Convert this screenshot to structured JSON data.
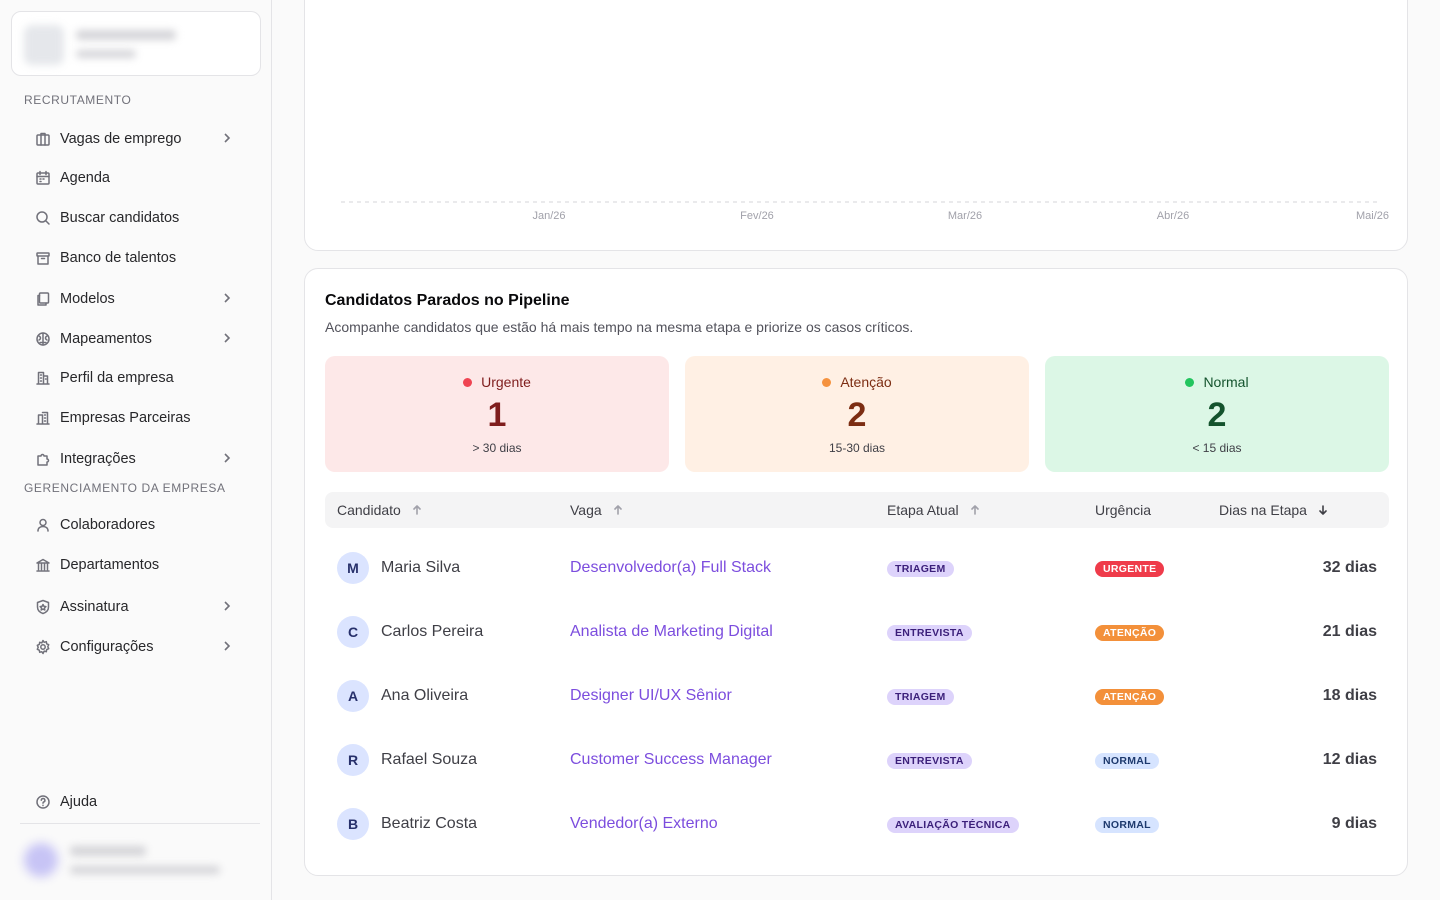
{
  "sidebar": {
    "sections": [
      {
        "label": "RECRUTAMENTO"
      },
      {
        "label": "GERENCIAMENTO DA EMPRESA"
      }
    ],
    "items": [
      {
        "label": "Vagas de emprego",
        "icon": "briefcase-icon"
      },
      {
        "label": "Agenda",
        "icon": "calendar-icon"
      },
      {
        "label": "Buscar candidatos",
        "icon": "search-icon"
      },
      {
        "label": "Banco de talentos",
        "icon": "archive-icon"
      },
      {
        "label": "Modelos",
        "icon": "copy-icon"
      },
      {
        "label": "Mapeamentos",
        "icon": "brain-icon"
      },
      {
        "label": "Perfil da empresa",
        "icon": "building-icon"
      },
      {
        "label": "Empresas Parceiras",
        "icon": "buildings-icon"
      },
      {
        "label": "Integrações",
        "icon": "puzzle-icon"
      },
      {
        "label": "Colaboradores",
        "icon": "user-icon"
      },
      {
        "label": "Departamentos",
        "icon": "landmark-icon"
      },
      {
        "label": "Assinatura",
        "icon": "shield-star-icon"
      },
      {
        "label": "Configurações",
        "icon": "gear-icon"
      }
    ],
    "help": {
      "label": "Ajuda",
      "icon": "help-circle-icon"
    }
  },
  "chart": {
    "x_labels": [
      "Jan/26",
      "Fev/26",
      "Mar/26",
      "Abr/26",
      "Mai/26"
    ]
  },
  "pipeline": {
    "title": "Candidatos Parados no Pipeline",
    "subtitle": "Acompanhe candidatos que estão há mais tempo na mesma etapa e priorize os casos críticos.",
    "stats": [
      {
        "label": "Urgente",
        "value": "1",
        "desc": "> 30 dias",
        "dot_color": "#ef4452"
      },
      {
        "label": "Atenção",
        "value": "2",
        "desc": "15-30 dias",
        "dot_color": "#f5923e"
      },
      {
        "label": "Normal",
        "value": "2",
        "desc": "< 15 dias",
        "dot_color": "#22c55e"
      }
    ],
    "columns": {
      "candidate": "Candidato",
      "job": "Vaga",
      "stage": "Etapa Atual",
      "urgency": "Urgência",
      "days": "Dias na Etapa"
    },
    "rows": [
      {
        "initial": "M",
        "name": "Maria Silva",
        "job": "Desenvolvedor(a) Full Stack",
        "stage": "TRIAGEM",
        "urgency": "URGENTE",
        "days": "32 dias"
      },
      {
        "initial": "C",
        "name": "Carlos Pereira",
        "job": "Analista de Marketing Digital",
        "stage": "ENTREVISTA",
        "urgency": "ATENÇÃO",
        "days": "21 dias"
      },
      {
        "initial": "A",
        "name": "Ana Oliveira",
        "job": "Designer UI/UX Sênior",
        "stage": "TRIAGEM",
        "urgency": "ATENÇÃO",
        "days": "18 dias"
      },
      {
        "initial": "R",
        "name": "Rafael Souza",
        "job": "Customer Success Manager",
        "stage": "ENTREVISTA",
        "urgency": "NORMAL",
        "days": "12 dias"
      },
      {
        "initial": "B",
        "name": "Beatriz Costa",
        "job": "Vendedor(a) Externo",
        "stage": "AVALIAÇÃO TÉCNICA",
        "urgency": "NORMAL",
        "days": "9 dias"
      }
    ]
  }
}
